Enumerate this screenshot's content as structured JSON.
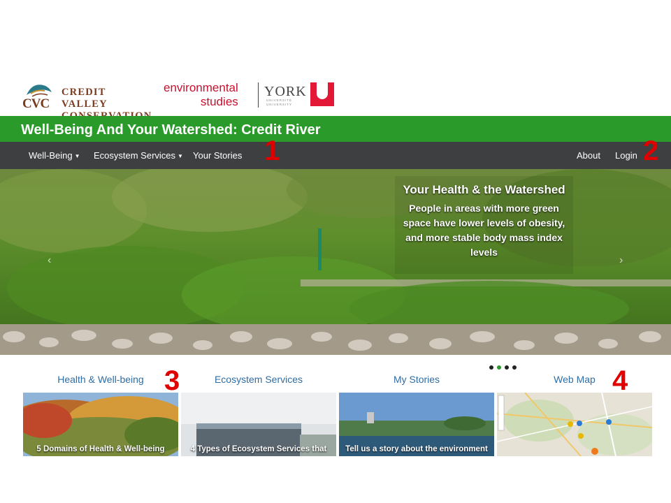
{
  "logos": {
    "cvc_letters": "CVC",
    "cvc_name_line1": "CREDIT VALLEY",
    "cvc_name_line2": "CONSERVATION",
    "env_line1": "environmental",
    "env_line2": "studies",
    "york_name": "YORK",
    "york_sub": "UNIVERSITÉ UNIVERSITY"
  },
  "site": {
    "title": "Well-Being And Your Watershed: Credit River"
  },
  "nav": {
    "left": [
      {
        "label": "Well-Being",
        "dropdown": true
      },
      {
        "label": "Ecosystem Services",
        "dropdown": true
      },
      {
        "label": "Your Stories",
        "dropdown": false
      }
    ],
    "right": [
      {
        "label": "About"
      },
      {
        "label": "Login"
      }
    ]
  },
  "hero": {
    "title": "Your Health & the Watershed",
    "text": "People in areas with more green space have lower levels of obesity, and more stable body mass index levels",
    "prev_icon": "chevron-left-icon",
    "next_icon": "chevron-right-icon",
    "prev_glyph": "‹",
    "next_glyph": "›",
    "slides_count": 4,
    "active_slide": 2
  },
  "markers": [
    "1",
    "2",
    "3",
    "4"
  ],
  "sections": [
    {
      "title": "Health & Well-being",
      "caption": "5 Domains of Health & Well-being"
    },
    {
      "title": "Ecosystem Services",
      "caption": "4 Types of Ecosystem Services that"
    },
    {
      "title": "My Stories",
      "caption": "Tell us a story about the environment"
    },
    {
      "title": "Web Map",
      "caption": ""
    }
  ],
  "colors": {
    "brand_green": "#2a9a2a",
    "nav_dark": "#3d3f40",
    "link_blue": "#2e6da4",
    "marker_red": "#e00000"
  }
}
